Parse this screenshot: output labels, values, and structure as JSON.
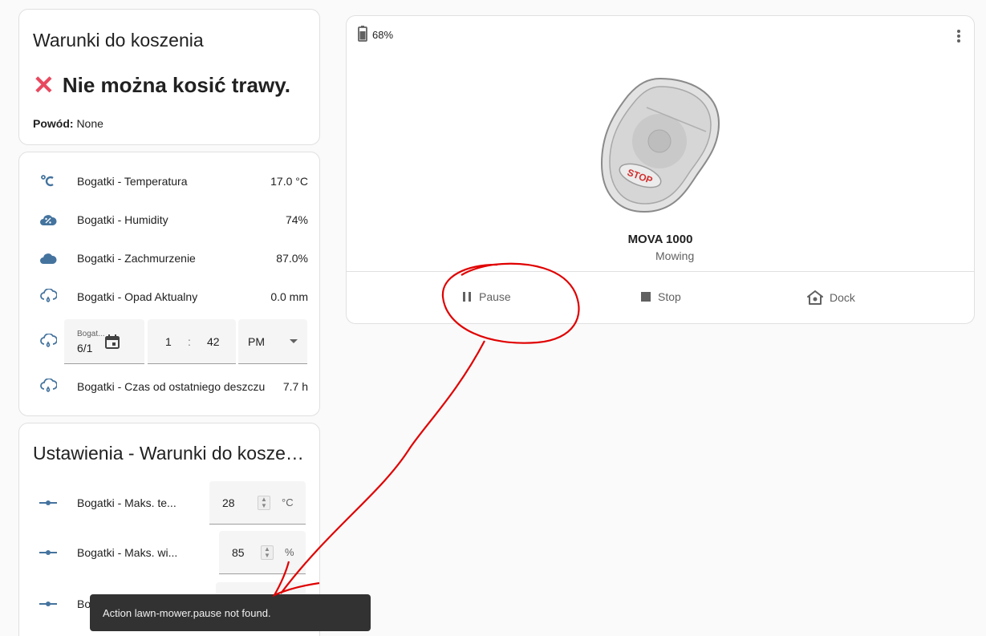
{
  "conditions": {
    "title": "Warunki do koszenia",
    "verdict_icon": "cross-mark-icon",
    "verdict": "Nie można kosić trawy.",
    "reason_label": "Powód:",
    "reason_value": "None"
  },
  "sensors": [
    {
      "icon": "thermometer-celsius-icon",
      "name": "Bogatki - Temperatura",
      "value": "17.0 °C"
    },
    {
      "icon": "cloud-percent-icon",
      "name": "Bogatki - Humidity",
      "value": "74%"
    },
    {
      "icon": "cloud-icon",
      "name": "Bogatki - Zachmurzenie",
      "value": "87.0%"
    },
    {
      "icon": "cloud-rain-icon",
      "name": "Bogatki - Opad Aktualny",
      "value": "0.0 mm"
    },
    {
      "icon": "cloud-rain-icon",
      "name": "Bogatki - Czas od ostatniego deszczu",
      "value": "7.7 h"
    }
  ],
  "datetime": {
    "label": "Bogat...",
    "date": "6/1",
    "hour": "1",
    "sep": ":",
    "minute": "42",
    "ampm": "PM"
  },
  "settings": {
    "title": "Ustawienia - Warunki do koszenia",
    "items": [
      {
        "name": "Bogatki - Maks. te...",
        "value": "28",
        "unit": "°C"
      },
      {
        "name": "Bogatki - Maks. wi...",
        "value": "85",
        "unit": "%"
      },
      {
        "name": "Bo"
      }
    ]
  },
  "mower": {
    "battery": "68%",
    "name": "MOVA 1000",
    "state": "Mowing",
    "image_text": "STOP",
    "actions": {
      "pause": "Pause",
      "stop": "Stop",
      "dock": "Dock"
    }
  },
  "toast": {
    "message": "Action lawn-mower.pause not found."
  },
  "colors": {
    "accent_icon": "#44739e",
    "error": "#e8495f",
    "annotation": "#e00000"
  }
}
